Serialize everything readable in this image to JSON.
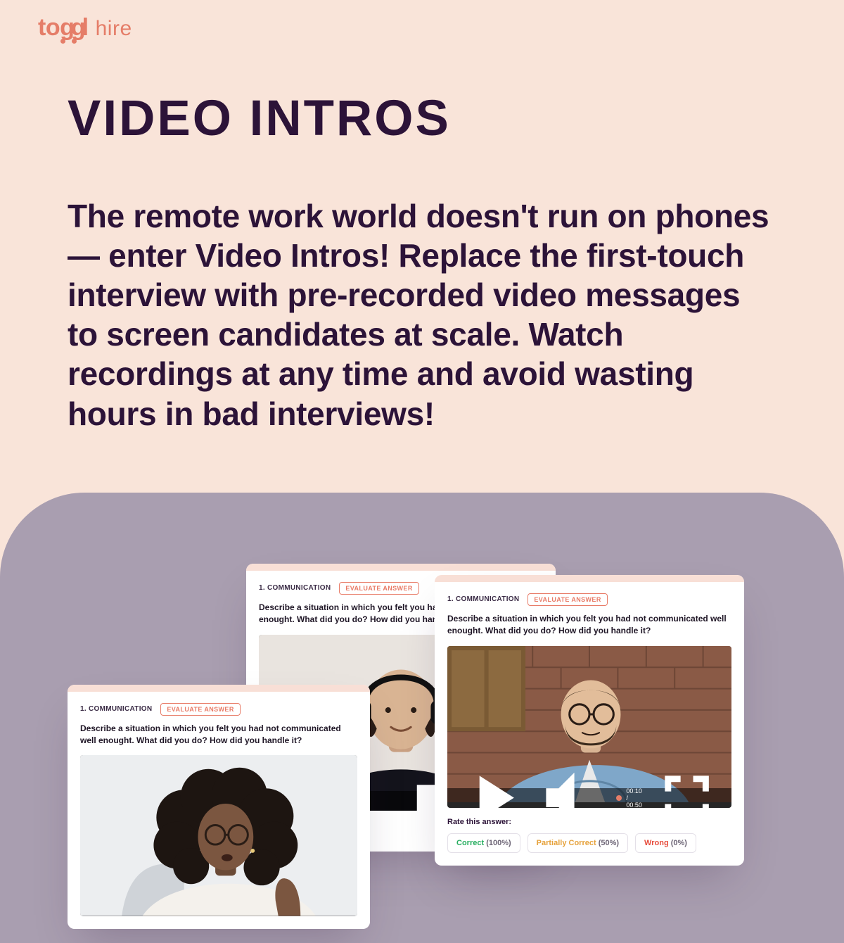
{
  "brand": {
    "mark": "toggl",
    "sub": "hire"
  },
  "hero": {
    "title": "VIDEO INTROS",
    "body": "The remote work world doesn't run on phones — enter Video Intros! Replace the first-touch interview with pre-recorded video messages to screen candidates at scale. Watch recordings at any time and avoid wasting hours in bad interviews!"
  },
  "card_shared": {
    "meta": "1. COMMUNICATION",
    "badge": "EVALUATE ANSWER",
    "question": "Describe a situation in which you felt you had not communicated well enought. What did you do? How did you handle it?"
  },
  "video": {
    "time": "00:10 / 00:50"
  },
  "rate": {
    "title": "Rate this answer:",
    "options": [
      {
        "name": "Correct",
        "pct": "(100%)",
        "tone": "green"
      },
      {
        "name": "Partially Correct",
        "pct": "(50%)",
        "tone": "amber"
      },
      {
        "name": "Wrong",
        "pct": "(0%)",
        "tone": "red"
      }
    ]
  },
  "wrong_pill": {
    "label": "Wrong",
    "pct": "(0%)"
  }
}
